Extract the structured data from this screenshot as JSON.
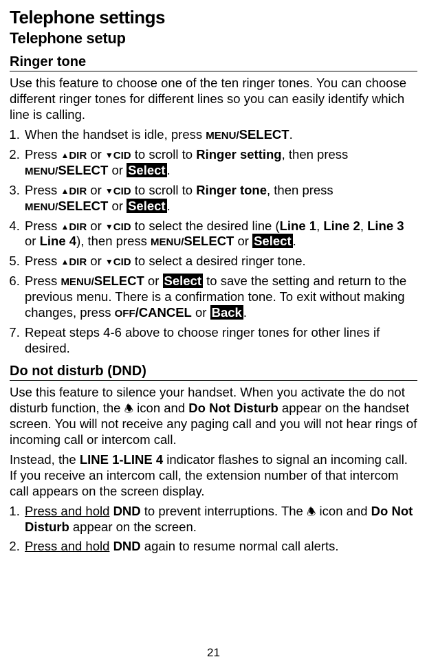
{
  "doc": {
    "title": "Telephone settings",
    "subtitle": "Telephone setup",
    "page_number": "21",
    "section1": {
      "heading": "Ringer tone",
      "intro": "Use this feature to choose one of the ten ringer tones. You can choose different ringer tones for different lines so you can easily identify which line is calling.",
      "s1": {
        "pre": "When the handset is idle, press ",
        "k1a": "MENU/",
        "k1b": "SELECT",
        "post": "."
      },
      "s2": {
        "pre": "Press ",
        "dir": "DIR",
        "or": " or ",
        "cid": "CID",
        "mid": " to scroll to ",
        "target": "Ringer setting",
        "then": ", then press ",
        "k1a": "MENU/",
        "k1b": "SELECT",
        "or2": " or ",
        "sel": "Select",
        "post": "."
      },
      "s3": {
        "pre": "Press ",
        "dir": "DIR",
        "or": " or ",
        "cid": "CID",
        "mid": " to scroll to ",
        "target": "Ringer tone",
        "then": ", then press ",
        "k1a": "MENU/",
        "k1b": "SELECT",
        "or2": " or ",
        "sel": "Select",
        "post": "."
      },
      "s4": {
        "pre": "Press ",
        "dir": "DIR",
        "or": " or ",
        "cid": "CID",
        "mid": " to select the desired line (",
        "l1": "Line 1",
        "c1": ", ",
        "l2": "Line 2",
        "c2": ", ",
        "l3": "Line 3",
        "or3": " or ",
        "l4": "Line 4",
        "then": "), then press ",
        "k1a": "MENU/",
        "k1b": "SELECT",
        "or2": " or ",
        "sel": "Select",
        "post": "."
      },
      "s5": {
        "pre": "Press ",
        "dir": "DIR",
        "or": " or ",
        "cid": "CID",
        "post": " to select a desired ringer tone."
      },
      "s6": {
        "pre": "Press ",
        "k1a": "MENU/",
        "k1b": "SELECT",
        "or": " or ",
        "sel": "Select",
        "mid": " to save the setting and return to the previous menu. There is a confirmation tone. To exit without making changes, press ",
        "k2a": "OFF",
        "k2b": "/CANCEL",
        "or2": " or ",
        "back": "Back",
        "post": "."
      },
      "s7": "Repeat steps 4-6 above to choose ringer tones for other lines if desired."
    },
    "section2": {
      "heading": "Do not disturb (DND)",
      "intro1a": "Use this feature to silence your handset. When you activate the do not disturb function, the ",
      "intro1b": " icon and ",
      "intro1c": "Do Not Disturb",
      "intro1d": " appear on the handset screen. You will not receive any paging call and you will not hear rings of incoming call or intercom call.",
      "intro2a": "Instead, the ",
      "intro2b": "LINE 1-LINE 4",
      "intro2c": " indicator flashes to signal an incoming call. If you receive an intercom call, the extension number of that intercom call appears on the screen display.",
      "s1": {
        "ph": "Press and hold",
        "sp": " ",
        "dnd": "DND",
        "mid": " to prevent interruptions. The ",
        "mid2": " icon and ",
        "nd": "Do Not Disturb",
        "post": " appear on the screen."
      },
      "s2": {
        "ph": "Press and hold",
        "sp": " ",
        "dnd": "DND",
        "post": " again to resume normal call alerts."
      }
    }
  }
}
